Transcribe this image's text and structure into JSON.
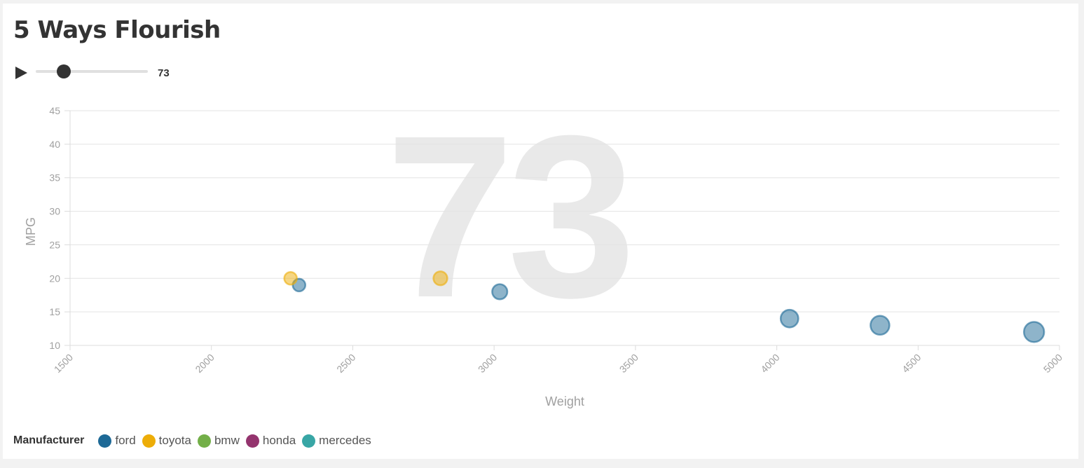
{
  "title": "5 Ways Flourish",
  "controls": {
    "play_icon": "play-icon",
    "slider_value": "73",
    "slider_fraction": 0.25
  },
  "legend": {
    "title": "Manufacturer",
    "items": [
      {
        "label": "ford",
        "color": "#1d6996"
      },
      {
        "label": "toyota",
        "color": "#edad08"
      },
      {
        "label": "bmw",
        "color": "#73af48"
      },
      {
        "label": "honda",
        "color": "#94346e"
      },
      {
        "label": "mercedes",
        "color": "#38a6a5"
      }
    ]
  },
  "chart_data": {
    "type": "scatter",
    "title": "5 Ways Flourish",
    "xlabel": "Weight",
    "ylabel": "MPG",
    "xlim": [
      1500,
      5000
    ],
    "ylim": [
      10,
      45
    ],
    "xticks": [
      1500,
      2000,
      2500,
      3000,
      3500,
      4000,
      4500,
      5000
    ],
    "yticks": [
      10,
      15,
      20,
      25,
      30,
      35,
      40,
      45
    ],
    "grid": true,
    "background_label": "73",
    "legend_position": "bottom-left",
    "series": [
      {
        "name": "ford",
        "color": "#1d6996",
        "points": [
          {
            "x": 2310,
            "y": 19,
            "size": 1
          },
          {
            "x": 3020,
            "y": 18,
            "size": 1.2
          },
          {
            "x": 4045,
            "y": 14,
            "size": 1.4
          },
          {
            "x": 4365,
            "y": 13,
            "size": 1.5
          },
          {
            "x": 4910,
            "y": 12,
            "size": 1.6
          }
        ]
      },
      {
        "name": "toyota",
        "color": "#edad08",
        "points": [
          {
            "x": 2280,
            "y": 20,
            "size": 1
          },
          {
            "x": 2810,
            "y": 20,
            "size": 1.1
          }
        ]
      }
    ]
  }
}
